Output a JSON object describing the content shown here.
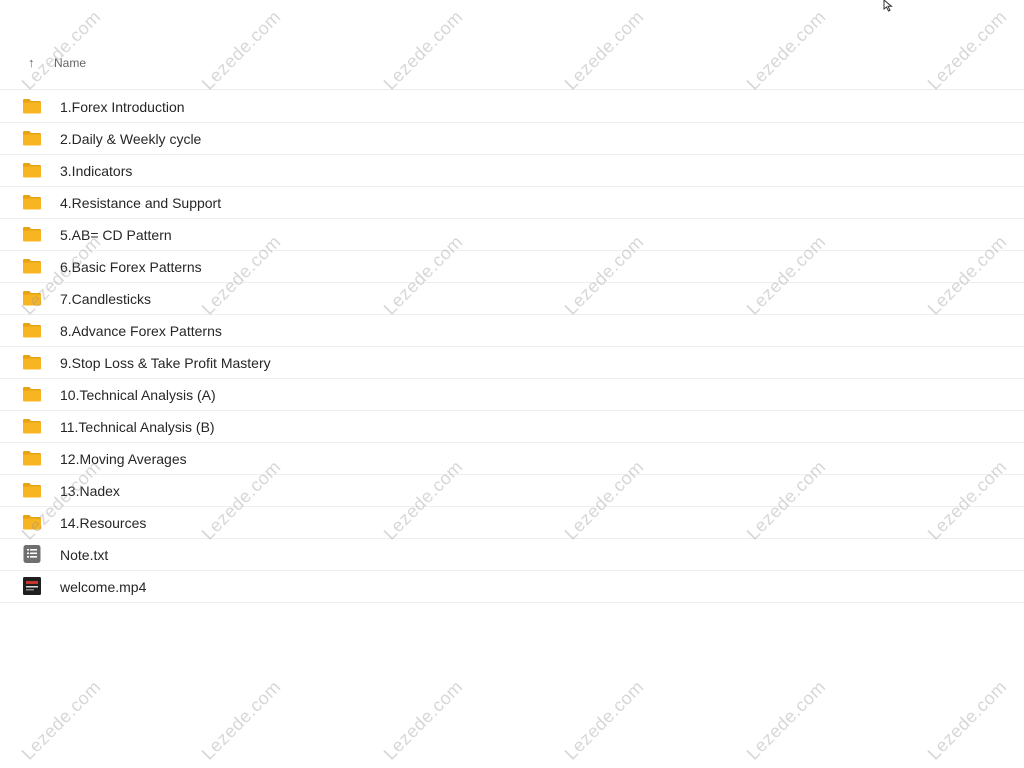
{
  "header": {
    "name_label": "Name",
    "sort_arrow": "↑"
  },
  "items": [
    {
      "label": "1.Forex Introduction",
      "type": "folder"
    },
    {
      "label": "2.Daily & Weekly cycle",
      "type": "folder"
    },
    {
      "label": "3.Indicators",
      "type": "folder"
    },
    {
      "label": "4.Resistance and Support",
      "type": "folder"
    },
    {
      "label": "5.AB= CD Pattern",
      "type": "folder"
    },
    {
      "label": "6.Basic Forex Patterns",
      "type": "folder"
    },
    {
      "label": "7.Candlesticks",
      "type": "folder"
    },
    {
      "label": "8.Advance Forex Patterns",
      "type": "folder"
    },
    {
      "label": "9.Stop Loss & Take Profit Mastery",
      "type": "folder"
    },
    {
      "label": "10.Technical Analysis (A)",
      "type": "folder"
    },
    {
      "label": "11.Technical Analysis (B)",
      "type": "folder"
    },
    {
      "label": "12.Moving Averages",
      "type": "folder"
    },
    {
      "label": "13.Nadex",
      "type": "folder"
    },
    {
      "label": "14.Resources",
      "type": "folder"
    },
    {
      "label": "Note.txt",
      "type": "text-file"
    },
    {
      "label": "welcome.mp4",
      "type": "video-file"
    }
  ],
  "watermark": "Lezede.com",
  "colors": {
    "folder": "#F7B521",
    "folder_tab": "#E9A312",
    "text_file": "#6f6f6f",
    "video_file": "#1f1f1f"
  }
}
